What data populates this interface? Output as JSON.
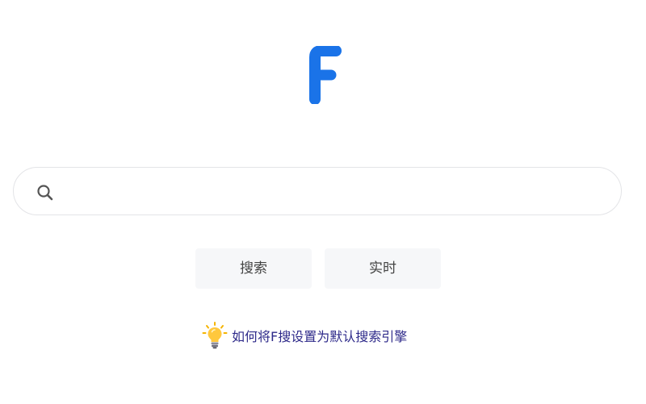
{
  "logo": {
    "letter": "F",
    "color": "#1a73e8"
  },
  "search": {
    "value": "",
    "placeholder": "",
    "icon": "search-icon"
  },
  "buttons": {
    "search_label": "搜索",
    "realtime_label": "实时"
  },
  "tip": {
    "icon": "lightbulb-icon",
    "text": "如何将F搜设置为默认搜索引擎"
  },
  "colors": {
    "brand": "#1a73e8",
    "button_bg": "#f6f7f9",
    "link": "#2e2a8a",
    "border": "#e3e4e7"
  }
}
